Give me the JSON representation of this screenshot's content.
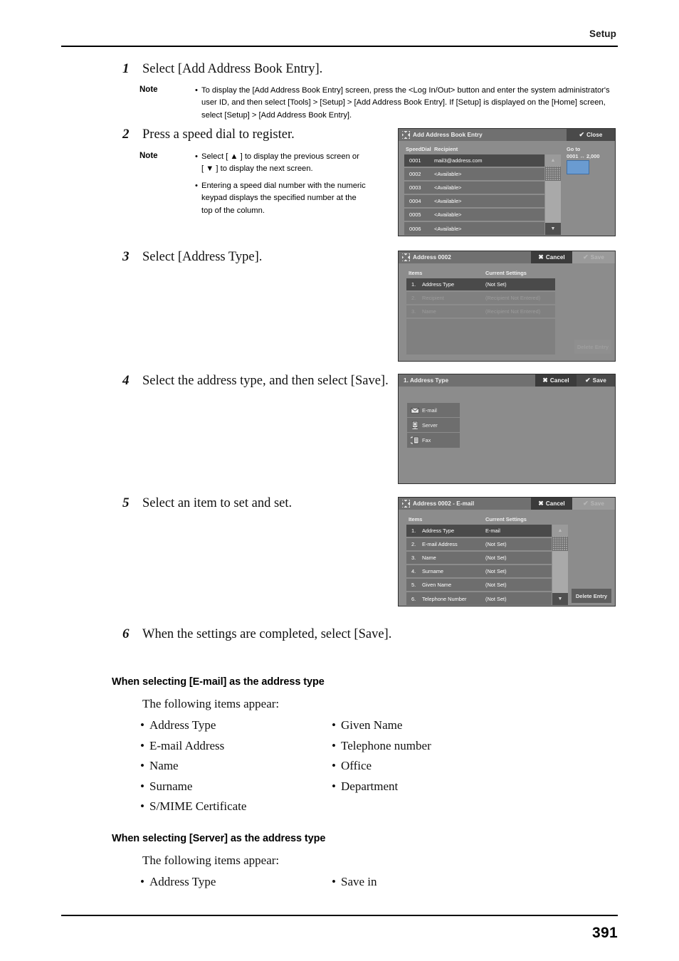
{
  "header": {
    "section": "Setup"
  },
  "footer": {
    "page_number": "391"
  },
  "steps": [
    {
      "num": "1",
      "text": "Select [Add Address Book Entry]."
    },
    {
      "num": "2",
      "text": "Press a speed dial to register."
    },
    {
      "num": "3",
      "text": "Select [Address Type]."
    },
    {
      "num": "4",
      "text": "Select the address type, and then select [Save]."
    },
    {
      "num": "5",
      "text": "Select an item to set and set."
    },
    {
      "num": "6",
      "text": "When the settings are completed, select [Save]."
    }
  ],
  "notes": {
    "label": "Note",
    "note1": [
      "To display the [Add Address Book Entry] screen, press the <Log In/Out> button and enter the system administrator's user ID, and then select [Tools] > [Setup] > [Add Address Book Entry]. If [Setup] is displayed on the [Home] screen, select [Setup] > [Add Address Book Entry]."
    ],
    "note2_line1": "Select [ ▲ ] to display the previous screen or",
    "note2_line2": "[ ▼ ] to display the next screen.",
    "note2_b_line1": "Entering a speed dial number with the numeric",
    "note2_b_line2": "keypad displays the specified number at the",
    "note2_b_line3": "top of the column.",
    "bullet": "•"
  },
  "panel1": {
    "title": "Add Address Book Entry",
    "close_label": "Close",
    "close_glyph": "✔",
    "col_speeddial": "SpeedDial",
    "col_recipient": "Recipient",
    "goto_label": "Go to",
    "goto_range": "0001 ↔ 2,000",
    "rows": [
      {
        "id": "0001",
        "value": "mail3@address.com"
      },
      {
        "id": "0002",
        "value": "<Available>"
      },
      {
        "id": "0003",
        "value": "<Available>"
      },
      {
        "id": "0004",
        "value": "<Available>"
      },
      {
        "id": "0005",
        "value": "<Available>"
      },
      {
        "id": "0006",
        "value": "<Available>"
      }
    ],
    "scroll_up": "▲",
    "scroll_down": "▼"
  },
  "panel2": {
    "title": "Address 0002",
    "cancel_label": "Cancel",
    "cancel_glyph": "✖",
    "save_label": "Save",
    "save_glyph": "✔",
    "col_items": "Items",
    "col_settings": "Current Settings",
    "delete_label": "Delete Entry",
    "rows": [
      {
        "num": "1.",
        "item": "Address Type",
        "setting": "(Not Set)"
      },
      {
        "num": "2.",
        "item": "Recipient",
        "setting": "(Recipient Not Entered)"
      },
      {
        "num": "3.",
        "item": "Name",
        "setting": "(Recipient Not Entered)"
      }
    ]
  },
  "panel3": {
    "title": "1. Address Type",
    "cancel_label": "Cancel",
    "cancel_glyph": "✖",
    "save_label": "Save",
    "save_glyph": "✔",
    "options": [
      {
        "label": "E-mail",
        "icon": "envelope-icon"
      },
      {
        "label": "Server",
        "icon": "server-icon"
      },
      {
        "label": "Fax",
        "icon": "fax-icon"
      }
    ]
  },
  "panel4": {
    "title": "Address 0002 - E-mail",
    "cancel_label": "Cancel",
    "cancel_glyph": "✖",
    "save_label": "Save",
    "save_glyph": "✔",
    "col_items": "Items",
    "col_settings": "Current Settings",
    "delete_label": "Delete Entry",
    "scroll_up": "▲",
    "scroll_down": "▼",
    "rows": [
      {
        "num": "1.",
        "item": "Address Type",
        "setting": "E-mail"
      },
      {
        "num": "2.",
        "item": "E-mail Address",
        "setting": "(Not Set)"
      },
      {
        "num": "3.",
        "item": "Name",
        "setting": "(Not Set)"
      },
      {
        "num": "4.",
        "item": "Surname",
        "setting": "(Not Set)"
      },
      {
        "num": "5.",
        "item": "Given Name",
        "setting": "(Not Set)"
      },
      {
        "num": "6.",
        "item": "Telephone Number",
        "setting": "(Not Set)"
      }
    ]
  },
  "section_email": {
    "heading": "When selecting [E-mail] as the address type",
    "intro": "The following items appear:",
    "left": [
      "Address Type",
      "E-mail Address",
      "Name",
      "Surname",
      "S/MIME Certificate"
    ],
    "right": [
      "Given Name",
      "Telephone number",
      "Office",
      "Department"
    ]
  },
  "section_server": {
    "heading": "When selecting [Server] as the address type",
    "intro": "The following items appear:",
    "left": [
      "Address Type"
    ],
    "right": [
      "Save in"
    ]
  },
  "colors": {
    "panel_bg": "#8c8c8c",
    "row_bg": "#6e6e6e",
    "row_selected": "#4a4a4a",
    "goto_input": "#6a9bd1",
    "text": "#111111"
  }
}
